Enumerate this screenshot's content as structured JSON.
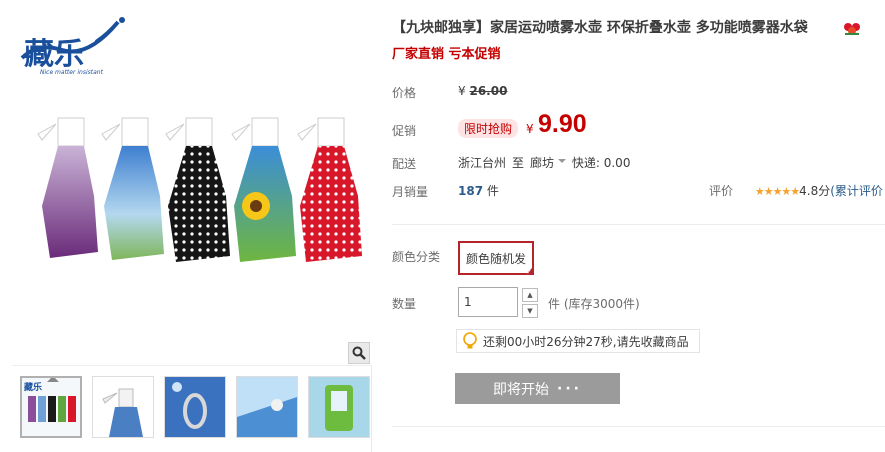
{
  "product": {
    "title": "【九块邮独享】家居运动喷雾水壶 环保折叠水壶 多功能喷雾器水袋",
    "subtitle": "厂家直销 亏本促销",
    "brand_logo_text": "藏乐",
    "brand_slogan": "Nice matter insistant"
  },
  "price": {
    "label": "价格",
    "currency": "¥",
    "original": "26.00",
    "promo_label": "促销",
    "promo_tag": "限时抢购",
    "promo_price": "9.90"
  },
  "shipping": {
    "label": "配送",
    "from": "浙江台州",
    "to_word": "至",
    "to": "廊坊",
    "express": "快递: 0.00"
  },
  "sales": {
    "label": "月销量",
    "count": "187",
    "unit": "件"
  },
  "rating": {
    "label": "评价",
    "stars": "★★★★★",
    "score": "4.8分",
    "cumulative": "(累计评价"
  },
  "color": {
    "label": "颜色分类",
    "selected": "颜色随机发",
    "accent": "#b4242a"
  },
  "quantity": {
    "label": "数量",
    "value": "1",
    "stock": "件 (库存3000件)"
  },
  "reminder": {
    "text": "还剩00小时26分钟27秒,请先收藏商品",
    "icon": "lightbulb-icon"
  },
  "action": {
    "label": "即将开始",
    "dots": "···"
  },
  "colors": {
    "price_red": "#c40000",
    "link_blue": "#2a5b8b",
    "button_gray": "#9b9b9b"
  }
}
